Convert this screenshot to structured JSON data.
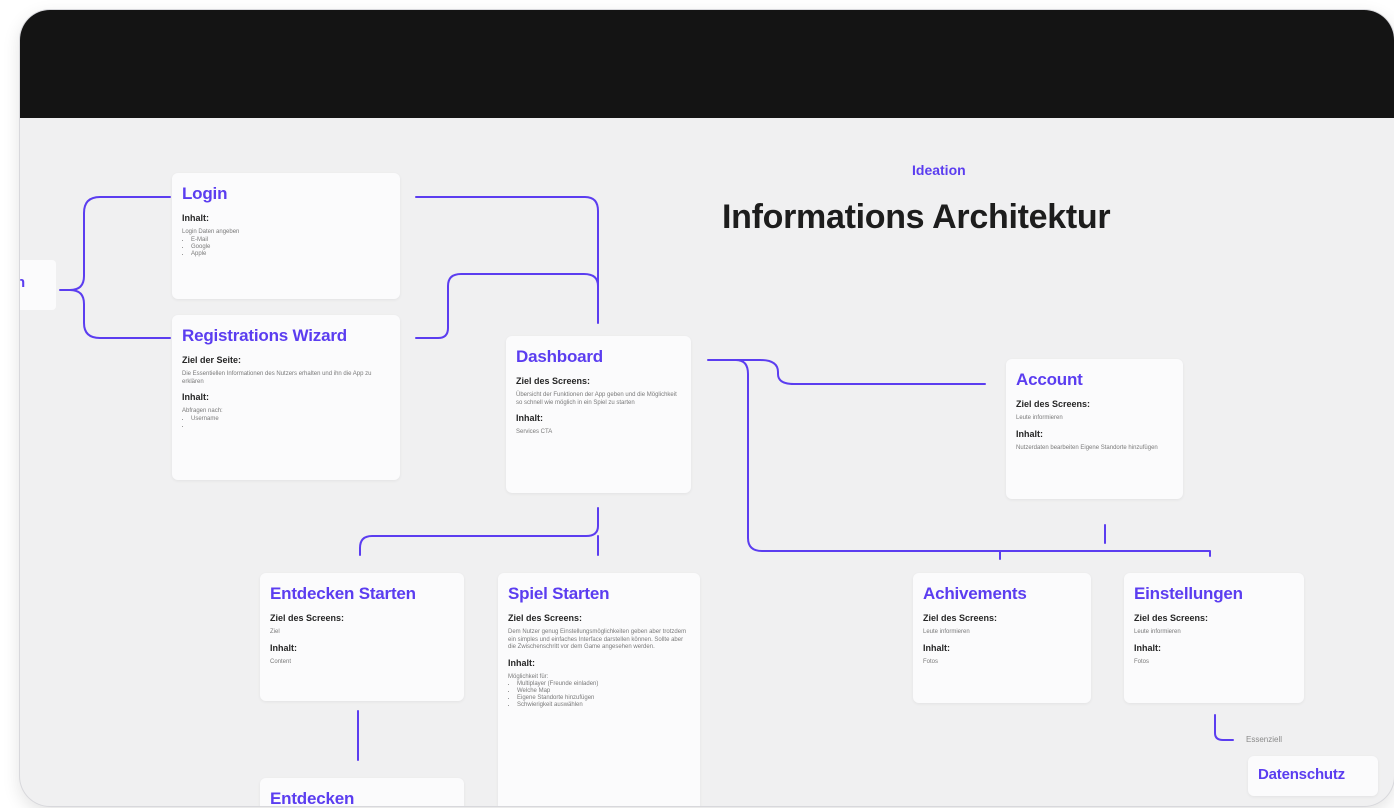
{
  "header": {
    "ideation": "Ideation",
    "title": "Informations Architektur"
  },
  "edge_label": "n",
  "cards": {
    "login": {
      "title": "Login",
      "label1": "Inhalt:",
      "text1": "Login Daten angeben",
      "items": [
        "E-Mail",
        "Google",
        "Apple"
      ]
    },
    "registration": {
      "title": "Registrations Wizard",
      "label1": "Ziel der Seite:",
      "text1": "Die Essentiellen Informationen des Nutzers erhalten und ihn die App zu erklären",
      "label2": "Inhalt:",
      "text2": "Abfragen nach:",
      "items": [
        "Username",
        ""
      ]
    },
    "dashboard": {
      "title": "Dashboard",
      "label1": "Ziel des Screens:",
      "text1": "Übersicht der Funktionen der App geben und die Möglichkeit so schnell wie möglich in ein Spiel zu starten",
      "label2": "Inhalt:",
      "text2": "Services CTA"
    },
    "account": {
      "title": "Account",
      "label1": "Ziel des Screens:",
      "text1": "Leute informieren",
      "label2": "Inhalt:",
      "text2": "Nutzerdaten bearbeiten Eigene Standorte hinzufügen"
    },
    "entdecken_starten": {
      "title": "Entdecken Starten",
      "label1": "Ziel des Screens:",
      "text1": "Ziel",
      "label2": "Inhalt:",
      "text2": "Content"
    },
    "spiel_starten": {
      "title": "Spiel Starten",
      "label1": "Ziel des Screens:",
      "text1": "Dem Nutzer genug Einstellungsmöglichkeiten geben aber trotzdem ein simples und einfaches Interface darstellen können. Sollte aber die Zwischenschritt vor dem Game angesehen werden.",
      "label2": "Inhalt:",
      "text2": "Möglichkeit für:",
      "items": [
        "Multiplayer (Freunde einladen)",
        "Welche Map",
        "Eigene Standorte hinzufügen",
        "Schwierigkeit auswählen"
      ]
    },
    "achivements": {
      "title": "Achivements",
      "label1": "Ziel des Screens:",
      "text1": "Leute informieren",
      "label2": "Inhalt:",
      "text2": "Fotos"
    },
    "einstellungen": {
      "title": "Einstellungen",
      "label1": "Ziel des Screens:",
      "text1": "Leute informieren",
      "label2": "Inhalt:",
      "text2": "Fotos"
    },
    "entdecken": {
      "title": "Entdecken"
    },
    "datenschutz": {
      "title": "Datenschutz"
    }
  },
  "notes": {
    "essenziell": "Essenziell"
  },
  "colors": {
    "accent": "#5b3df0",
    "topbar": "#141414",
    "canvas": "#f0f0f1",
    "card": "#fbfbfc"
  }
}
